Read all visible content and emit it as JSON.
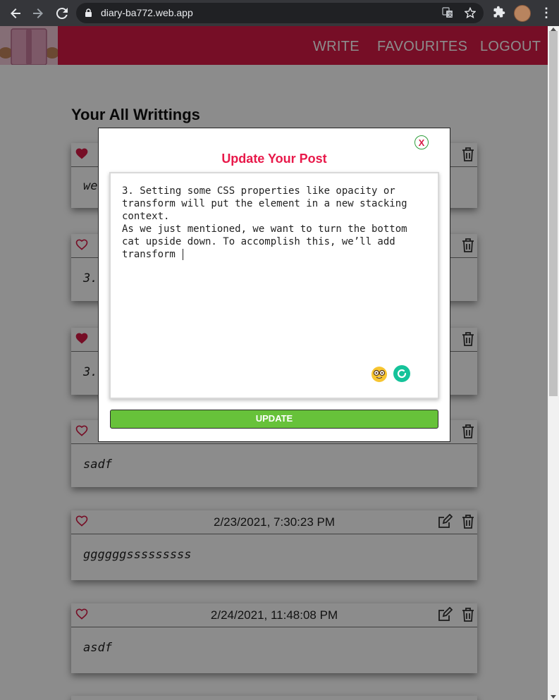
{
  "browser": {
    "url": "diary-ba772.web.app",
    "icons": [
      "back-arrow-icon",
      "forward-arrow-icon",
      "reload-icon",
      "lock-icon",
      "translate-icon",
      "star-icon",
      "extensions-icon",
      "profile-avatar",
      "menu-kebab-icon"
    ]
  },
  "nav": {
    "links": [
      "WRITE",
      "FAVOURITES",
      "LOGOUT"
    ],
    "brand_color": "#d81b46"
  },
  "page": {
    "title": "Your All Writtings"
  },
  "posts": [
    {
      "favourite": true,
      "date": "",
      "body": "we"
    },
    {
      "favourite": false,
      "date": "",
      "body": "3."
    },
    {
      "favourite": true,
      "date": "",
      "body": "3."
    },
    {
      "favourite": false,
      "date": "",
      "body": "sadf"
    },
    {
      "favourite": false,
      "date": "2/23/2021, 7:30:23 PM",
      "body": "ggggggsssssssss"
    },
    {
      "favourite": false,
      "date": "2/24/2021, 11:48:08 PM",
      "body": "asdf"
    }
  ],
  "modal": {
    "close_label": "X",
    "title": "Update Your Post",
    "text_lines": [
      "3. Setting some CSS properties like opacity or",
      "transform will put the element in a new stacking",
      "context.",
      "As we just mentioned, we want to turn the bottom",
      "cat upside down. To accomplish this, we’ll add",
      "transform "
    ],
    "update_label": "UPDATE",
    "accent_color": "#e8194a",
    "button_color": "#67c23a"
  }
}
